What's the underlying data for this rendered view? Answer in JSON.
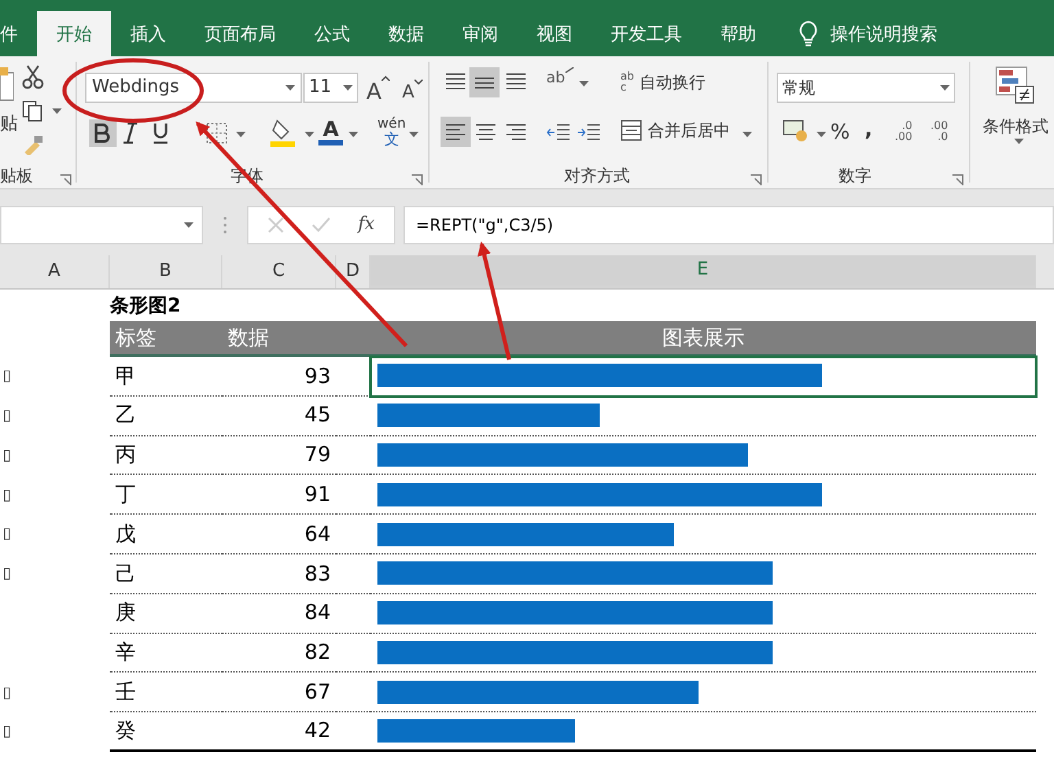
{
  "ribbon_tabs": [
    {
      "label": "件",
      "selected": false
    },
    {
      "label": "开始",
      "selected": true
    },
    {
      "label": "插入",
      "selected": false
    },
    {
      "label": "页面布局",
      "selected": false
    },
    {
      "label": "公式",
      "selected": false
    },
    {
      "label": "数据",
      "selected": false
    },
    {
      "label": "审阅",
      "selected": false
    },
    {
      "label": "视图",
      "selected": false
    },
    {
      "label": "开发工具",
      "selected": false
    },
    {
      "label": "帮助",
      "selected": false
    }
  ],
  "tell_me": "操作说明搜索",
  "ribbon": {
    "clipboard": {
      "paste_label": "贴",
      "group_label": "贴板"
    },
    "font": {
      "font_name": "Webdings",
      "font_size": "11",
      "grow_font": "A",
      "shrink_font": "A",
      "font_color": "A",
      "phonetic": "wén",
      "phonetic_char": "文",
      "group_label": "字体"
    },
    "alignment": {
      "orientation": "ab",
      "wrap_icon": [
        "ab",
        "c"
      ],
      "wrap_text": "自动换行",
      "merge_center": "合并后居中",
      "group_label": "对齐方式"
    },
    "number": {
      "format": "常规",
      "percent": "%",
      "comma": ",",
      "increase_decimal": [
        ".0",
        ".00"
      ],
      "decrease_decimal": [
        ".00",
        ".0"
      ],
      "group_label": "数字"
    },
    "styles": {
      "conditional_format": "条件格式"
    }
  },
  "formula_bar": {
    "fx": "fx",
    "formula": "=REPT(\"g\",C3/5)"
  },
  "columns": [
    {
      "label": "A",
      "selected": false
    },
    {
      "label": "B",
      "selected": false
    },
    {
      "label": "C",
      "selected": false
    },
    {
      "label": "D",
      "selected": false
    },
    {
      "label": "E",
      "selected": true
    }
  ],
  "sheet": {
    "title": "条形图2",
    "headers": [
      "标签",
      "数据",
      "图表展示"
    ],
    "rows": [
      {
        "column_a": "▯",
        "label": "甲",
        "value": "93",
        "level": 0.684,
        "selected": true
      },
      {
        "column_a": "▯",
        "label": "乙",
        "value": "45",
        "level": 0.342,
        "selected": false
      },
      {
        "column_a": "▯",
        "label": "丙",
        "value": "79",
        "level": 0.57,
        "selected": false
      },
      {
        "column_a": "▯",
        "label": "丁",
        "value": "91",
        "level": 0.684,
        "selected": false
      },
      {
        "column_a": "▯",
        "label": "戊",
        "value": "64",
        "level": 0.456,
        "selected": false
      },
      {
        "column_a": "▯",
        "label": "己",
        "value": "83",
        "level": 0.608,
        "selected": false
      },
      {
        "label": "庚",
        "value": "84",
        "level": 0.608,
        "selected": false
      },
      {
        "label": "辛",
        "value": "82",
        "level": 0.608,
        "selected": false
      },
      {
        "column_a": "▯",
        "label": "壬",
        "value": "67",
        "level": 0.494,
        "selected": false
      },
      {
        "column_a": "▯",
        "label": "癸",
        "value": "42",
        "level": 0.304,
        "selected": false
      }
    ]
  }
}
